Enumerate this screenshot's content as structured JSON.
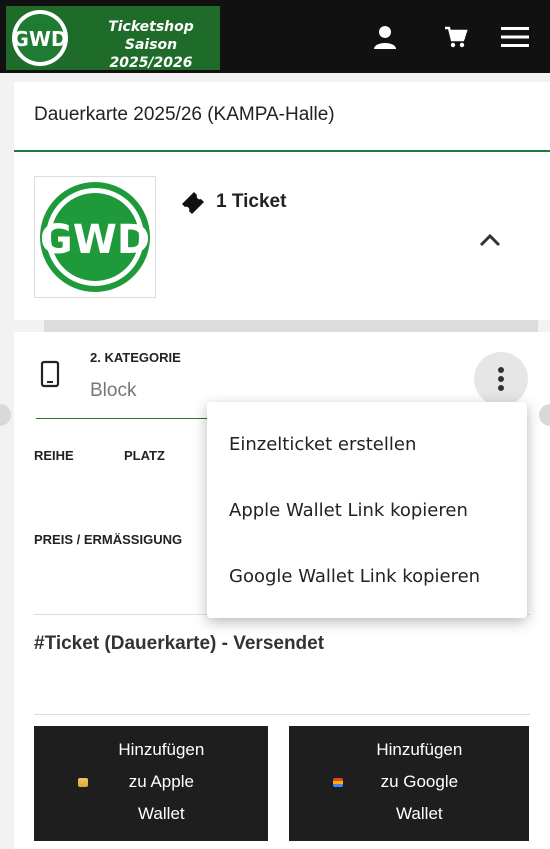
{
  "header": {
    "banner_line1": "Ticketshop",
    "banner_line2": "Saison 2025/2026",
    "logo_text": "GWD",
    "icons": [
      "user-icon",
      "cart-icon",
      "menu-icon"
    ]
  },
  "event": {
    "title": "Dauerkarte 2025/26 (KAMPA-Halle)",
    "ticket_count": "1 Ticket"
  },
  "ticket": {
    "category": "2. KATEGORIE",
    "block": "Block",
    "row_label": "REIHE",
    "seat_label": "PLATZ",
    "price_label": "PREIS / ERMÄSSIGUNG",
    "title": "#Ticket (Dauerkarte) - Versendet"
  },
  "wallet": {
    "apple_line1": "Hinzufügen",
    "apple_line2": "zu Apple",
    "apple_line3": "Wallet",
    "google_line1": "Hinzufügen",
    "google_line2": "zu Google",
    "google_line3": "Wallet"
  },
  "menu": {
    "items": [
      "Einzelticket erstellen",
      "Apple Wallet Link kopieren",
      "Google Wallet Link kopieren"
    ]
  },
  "colors": {
    "brand_green": "#1f7a32",
    "header_bg": "#111111",
    "button_bg": "#1e1e1e"
  }
}
